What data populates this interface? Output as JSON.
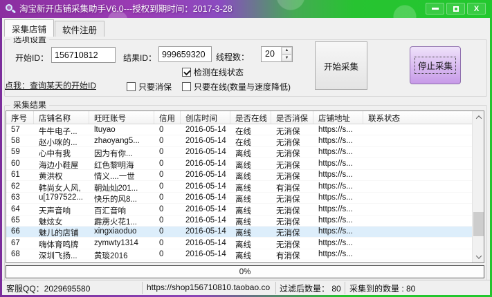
{
  "window": {
    "title": "淘宝新开店铺采集助手V6.0---授权到期时间：2017-3-28"
  },
  "tabs": [
    {
      "label": "采集店铺",
      "active": true
    },
    {
      "label": "软件注册",
      "active": false
    }
  ],
  "options": {
    "group_title": "选项设置",
    "start_id_label": "开始ID：",
    "start_id_value": "156710812",
    "result_id_label": "结果ID：",
    "result_id_value": "999659320",
    "threads_label": "线程数：",
    "threads_value": "20",
    "check_online_label": "检测在线状态",
    "check_online_checked": true,
    "query_link_label": "点我：查询某天的开始ID",
    "only_protection_label": "只要消保",
    "only_online_label": "只要在线(数量与速度降低)",
    "start_button_label": "开始采集",
    "stop_button_label": "停止采集"
  },
  "results": {
    "group_title": "采集结果",
    "columns": [
      "序号",
      "店铺名称",
      "旺旺账号",
      "信用",
      "创店时间",
      "是否在线",
      "是否消保",
      "店铺地址",
      "联系状态"
    ],
    "selected_index": 9,
    "rows": [
      [
        "57",
        "牛牛电子...",
        "ltuyao",
        "0",
        "2016-05-14",
        "在线",
        "无消保",
        "https://s...",
        ""
      ],
      [
        "58",
        "赵小咪的...",
        "zhaoyang5...",
        "0",
        "2016-05-14",
        "在线",
        "无消保",
        "https://s...",
        ""
      ],
      [
        "59",
        "心中有我",
        "因为有你...",
        "0",
        "2016-05-14",
        "离线",
        "无消保",
        "https://s...",
        ""
      ],
      [
        "60",
        "海边小鞋屋",
        "红色黎明海",
        "0",
        "2016-05-14",
        "离线",
        "无消保",
        "https://s...",
        ""
      ],
      [
        "61",
        "黄洪权",
        "情义....一世",
        "0",
        "2016-05-14",
        "离线",
        "无消保",
        "https://s...",
        ""
      ],
      [
        "62",
        "韩尚女人风,",
        "朝灿灿201...",
        "0",
        "2016-05-14",
        "离线",
        "有消保",
        "https://s...",
        ""
      ],
      [
        "63",
        "u[1797522...",
        "快乐的风8...",
        "0",
        "2016-05-14",
        "离线",
        "无消保",
        "https://s...",
        ""
      ],
      [
        "64",
        "天声音响",
        "百汇音响",
        "0",
        "2016-05-14",
        "离线",
        "无消保",
        "https://s...",
        ""
      ],
      [
        "65",
        "魅炫女",
        "霹雳火花1...",
        "0",
        "2016-05-14",
        "离线",
        "无消保",
        "https://s...",
        ""
      ],
      [
        "66",
        "魅儿的店铺",
        "xingxiaoduo",
        "0",
        "2016-05-14",
        "离线",
        "无消保",
        "https://s...",
        ""
      ],
      [
        "67",
        "嗨体育鸣牌",
        "zymwty1314",
        "0",
        "2016-05-14",
        "离线",
        "无消保",
        "https://s...",
        ""
      ],
      [
        "68",
        "深圳飞扬...",
        "黄琰2016",
        "0",
        "2016-05-14",
        "离线",
        "有消保",
        "https://s...",
        ""
      ]
    ]
  },
  "progress": {
    "value": "0%"
  },
  "status_bar": {
    "qq": "客服QQ：2029695580",
    "url": "https://shop156710810.taobao.co",
    "filtered": "过滤后数量： 80",
    "collected": "采集到的数量 : 80"
  },
  "colors": {
    "titlebar_purple": "#8b2fa0",
    "titlebar_green": "#22c82e",
    "border_left_purple": "#7b2d9b",
    "border_right_green": "#24c42e",
    "stop_button_top": "#efe2fa",
    "stop_button_bottom": "#c79ae8",
    "stop_button_border": "#8f6fae",
    "selected_row_blue": "#ddeefb",
    "content_background": "#f0f0f0"
  }
}
